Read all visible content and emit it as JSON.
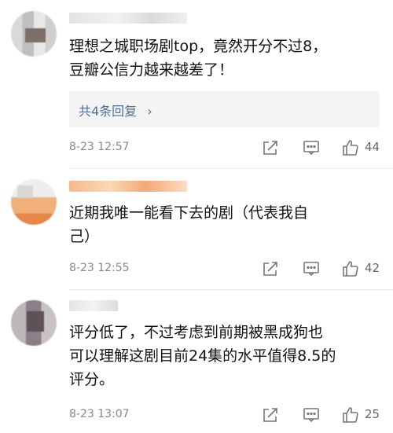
{
  "comments": [
    {
      "text_line1": "理想之城职场剧top，竟然开分不过8，",
      "text_line2": "豆瓣公信力越来越差了！",
      "reply_label": "共4条回复",
      "reply_chevron": "›",
      "time": "8-23 12:57",
      "likes": "44"
    },
    {
      "text_line1": "近期我唯一能看下去的剧（代表我自",
      "text_line2": "己）",
      "time": "8-23 12:55",
      "likes": "42"
    },
    {
      "text_line1": "评分低了，不过考虑到前期被黑成狗也",
      "text_line2": "可以理解这剧目前24集的水平值得8.5的",
      "text_line3": "评分。",
      "time": "8-23 13:07",
      "likes": "25"
    }
  ],
  "icons": {
    "share": "share-icon",
    "comment": "comment-icon",
    "like": "thumbs-up-icon"
  },
  "colors": {
    "link": "#4a6fa0",
    "meta": "#888888",
    "reply_bg": "#f4f4f4"
  }
}
